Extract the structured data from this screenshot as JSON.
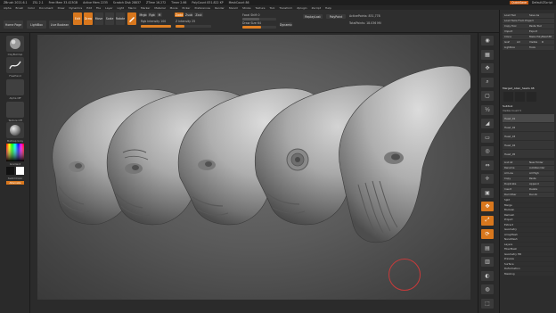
{
  "titlebar": {
    "items": [
      "ZBrush 2021.6.1",
      "ZSL 2.1",
      "Free Mem 33.423GB",
      "Active Mem 2235",
      "Scratch Disk 28837",
      "ZTime 16.272",
      "Timer 2.66",
      "PolyCount 831.822 KP",
      "MeshCount 86"
    ],
    "quicksave": "QuickSave",
    "default_label": "DefaultZScript"
  },
  "menubar": {
    "items": [
      "Alpha",
      "Brush",
      "Color",
      "Document",
      "Draw",
      "Dynamics",
      "Edit",
      "File",
      "Layer",
      "Light",
      "Macro",
      "Marker",
      "Material",
      "Movie",
      "Picker",
      "Preferences",
      "Render",
      "Stencil",
      "Stroke",
      "Texture",
      "Tool",
      "Transform",
      "Zplugin",
      "Zscript",
      "Help"
    ]
  },
  "toolbar": {
    "home_page": "Home Page",
    "lightbox": "LightBox",
    "live_boolean": "Live Boolean",
    "edit": "Edit",
    "draw": "Draw",
    "move": "Move",
    "scale": "Scale",
    "rotate": "Rotate",
    "mrgb": "Mrgb",
    "rgb": "Rgb",
    "m": "M",
    "zadd": "Zadd",
    "zsub": "Zsub",
    "zcut": "Zcut",
    "focal_shift_label": "Focal Shift",
    "focal_shift_value": "0",
    "draw_size_label": "Draw Size",
    "draw_size_value": "64",
    "dynamic": "Dynamic",
    "rgb_intensity_label": "Rgb Intensity",
    "rgb_intensity_value": "100",
    "z_intensity_label": "Z Intensity",
    "z_intensity_value": "25",
    "z_intensity_fraction": 0.25,
    "draw_size_fraction": 0.55,
    "active_points": "ActivePoints: 831,778",
    "total_points": "TotalPoints: 18.036 Mil",
    "polypaint": "PolyPaint",
    "replay_last": "ReplayLast"
  },
  "left_tray": {
    "brush_label": "ClayBuildup",
    "stroke_label": "FreeHand",
    "alpha_label": "Alpha Off",
    "texture_label": "Texture Off",
    "material_label": "MatCap Gray",
    "gradient": "Gradient",
    "switch_color": "SwitchColor",
    "alternate": "Alternate"
  },
  "right_shelf": {
    "icons": [
      "bpr-icon",
      "spix-icon",
      "scroll-icon",
      "zoom-icon",
      "actual-icon",
      "aahalf-icon",
      "persp-icon",
      "floor-icon",
      "local-icon",
      "lsym-icon",
      "xyz-icon",
      "frame-icon",
      "move-icon",
      "scale-icon",
      "rotate-icon",
      "linefill-icon",
      "polyf-icon",
      "transp-icon",
      "solo-icon",
      "xpose-icon"
    ],
    "labels": [
      "BPR",
      "SPix 3",
      "Scroll",
      "Zoom",
      "Actual",
      "AAHalf",
      "Persp",
      "Floor",
      "Local",
      "L.Sym",
      "Xyz",
      "Frame",
      "Move",
      "Scale",
      "Rotate",
      "Line Fill",
      "PolyF",
      "Transp",
      "Solo",
      "Xpose"
    ]
  },
  "right_panel": {
    "rows": [
      [
        "Load Tool",
        "Save As"
      ],
      [
        "Load Tools From Project",
        ""
      ],
      [
        "Copy Tool",
        "Paste Tool"
      ],
      [
        "Import",
        "Export"
      ],
      [
        "Clone",
        "Make PolyMesh3D"
      ],
      [
        "GoZ",
        "All",
        "Visible",
        "R"
      ],
      [
        "Lightbox",
        "Tools"
      ]
    ],
    "current_tool": "Merged_Alien_heads",
    "current_tool_value": "48",
    "subtool_header": "Subtool",
    "visible_count_label": "Visible Count 5",
    "subtools": [
      "Head_01",
      "Head_02",
      "Head_03",
      "Head_04",
      "Head_05"
    ],
    "list_all": "List All",
    "new_folder": "New Folder",
    "rename": "Rename",
    "auto_reorder": "AutoReorder",
    "all_low": "All Low",
    "all_high": "All High",
    "copy": "Copy",
    "paste": "Paste",
    "duplicate": "Duplicate",
    "append": "Append",
    "insert": "Insert",
    "delete": "Delete",
    "del_other": "Del Other",
    "del_all": "Del All",
    "sections": [
      "Split",
      "Merge",
      "Boolean",
      "Remesh",
      "Project",
      "Extract",
      "Geometry",
      "ArrayMesh",
      "NanoMesh",
      "Layers",
      "FiberMesh",
      "Geometry HD",
      "Preview",
      "Surface",
      "Deformation",
      "Masking"
    ]
  },
  "viewport": {
    "model_count": 5
  },
  "colors": {
    "accent": "#d8771d",
    "panel": "#2d2d2d",
    "viewport_bg": "#5a5a5a",
    "stroke_cursor": "#c83a3a"
  }
}
